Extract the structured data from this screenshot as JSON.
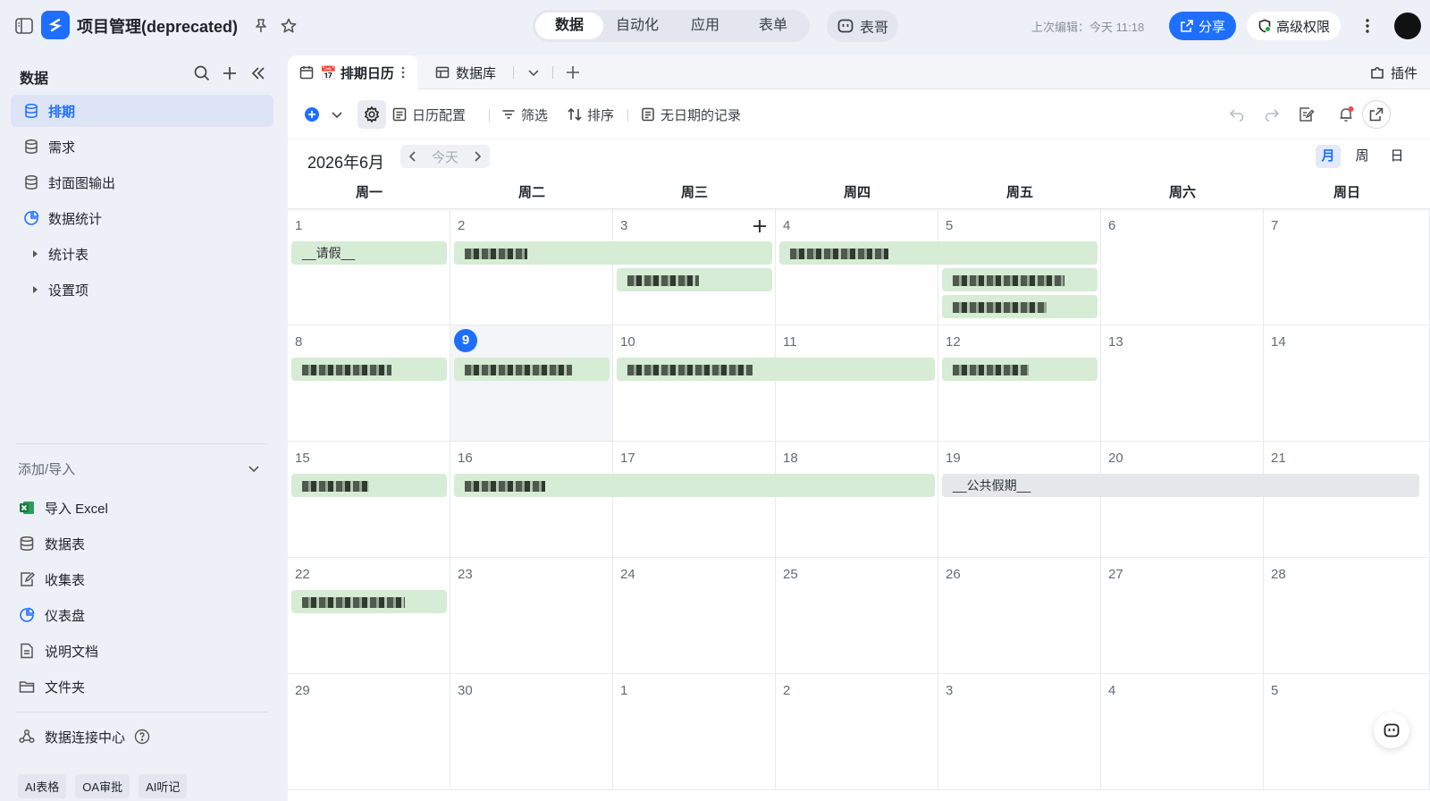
{
  "header": {
    "app_title": "项目管理(deprecated)",
    "tabs": [
      {
        "label": "数据",
        "active": true
      },
      {
        "label": "自动化",
        "active": false
      },
      {
        "label": "应用",
        "active": false
      },
      {
        "label": "表单",
        "active": false
      }
    ],
    "ai_label": "表哥",
    "last_edit": "上次编辑：今天 11:18",
    "share_label": "分享",
    "permission_label": "高级权限",
    "accent_color": "#1e6fff"
  },
  "sidebar": {
    "title": "数据",
    "items": [
      {
        "label": "排期",
        "icon": "database-icon",
        "active": true
      },
      {
        "label": "需求",
        "icon": "database-icon"
      },
      {
        "label": "封面图输出",
        "icon": "database-icon"
      },
      {
        "label": "数据统计",
        "icon": "dashboard-icon"
      },
      {
        "label": "统计表",
        "icon": "caret-right-icon"
      },
      {
        "label": "设置项",
        "icon": "caret-right-icon"
      }
    ],
    "add_section_title": "添加/导入",
    "add_items": [
      {
        "label": "导入 Excel",
        "icon": "excel-icon"
      },
      {
        "label": "数据表",
        "icon": "database-icon"
      },
      {
        "label": "收集表",
        "icon": "form-icon"
      },
      {
        "label": "仪表盘",
        "icon": "dashboard-icon"
      },
      {
        "label": "说明文档",
        "icon": "doc-icon"
      },
      {
        "label": "文件夹",
        "icon": "folder-icon"
      }
    ],
    "connect_center": "数据连接中心",
    "tags": [
      "AI表格",
      "OA审批",
      "AI听记"
    ]
  },
  "views": {
    "active_tab": "📅 排期日历",
    "other_tab": "数据库",
    "plugin_label": "插件"
  },
  "toolbar": {
    "calendar_config": "日历配置",
    "filter": "筛选",
    "sort": "排序",
    "no_date_records": "无日期的记录"
  },
  "calendar": {
    "month_label": "2026年6月",
    "today_label": "今天",
    "modes": [
      "月",
      "周",
      "日"
    ],
    "active_mode": "月",
    "weekdays": [
      "周一",
      "周二",
      "周三",
      "周四",
      "周五",
      "周六",
      "周日"
    ],
    "weeks": [
      [
        "1",
        "2",
        "3",
        "4",
        "5",
        "6",
        "7"
      ],
      [
        "8",
        "9",
        "10",
        "11",
        "12",
        "13",
        "14"
      ],
      [
        "15",
        "16",
        "17",
        "18",
        "19",
        "20",
        "21"
      ],
      [
        "22",
        "23",
        "24",
        "25",
        "26",
        "27",
        "28"
      ],
      [
        "29",
        "30",
        "1",
        "2",
        "3",
        "4",
        "5"
      ]
    ],
    "today_date": "9",
    "events": [
      {
        "week": 0,
        "start": 0,
        "span": 1,
        "lane": 0,
        "text": "__请假__"
      },
      {
        "week": 0,
        "start": 1,
        "span": 2,
        "lane": 0,
        "text": "",
        "blurred": 70
      },
      {
        "week": 0,
        "start": 2,
        "span": 1,
        "lane": 1,
        "text": "",
        "blurred": 80
      },
      {
        "week": 0,
        "start": 3,
        "span": 2,
        "lane": 0,
        "text": "",
        "blurred": 110
      },
      {
        "week": 0,
        "start": 4,
        "span": 1,
        "lane": 1,
        "text": "",
        "blurred": 125
      },
      {
        "week": 0,
        "start": 4,
        "span": 1,
        "lane": 2,
        "text": "",
        "blurred": 105
      },
      {
        "week": 1,
        "start": 0,
        "span": 1,
        "lane": 0,
        "text": "",
        "blurred": 100
      },
      {
        "week": 1,
        "start": 1,
        "span": 1,
        "lane": 0,
        "text": "",
        "blurred": 120
      },
      {
        "week": 1,
        "start": 2,
        "span": 2,
        "lane": 0,
        "text": "",
        "blurred": 140
      },
      {
        "week": 1,
        "start": 4,
        "span": 1,
        "lane": 0,
        "text": "",
        "blurred": 85
      },
      {
        "week": 2,
        "start": 0,
        "span": 1,
        "lane": 0,
        "text": "",
        "blurred": 75
      },
      {
        "week": 2,
        "start": 1,
        "span": 3,
        "lane": 0,
        "text": "",
        "blurred": 90
      },
      {
        "week": 2,
        "start": 4,
        "span": 3,
        "lane": 0,
        "text": "__公共假期__",
        "grey": true
      },
      {
        "week": 3,
        "start": 0,
        "span": 1,
        "lane": 0,
        "text": "",
        "blurred": 115
      }
    ]
  }
}
